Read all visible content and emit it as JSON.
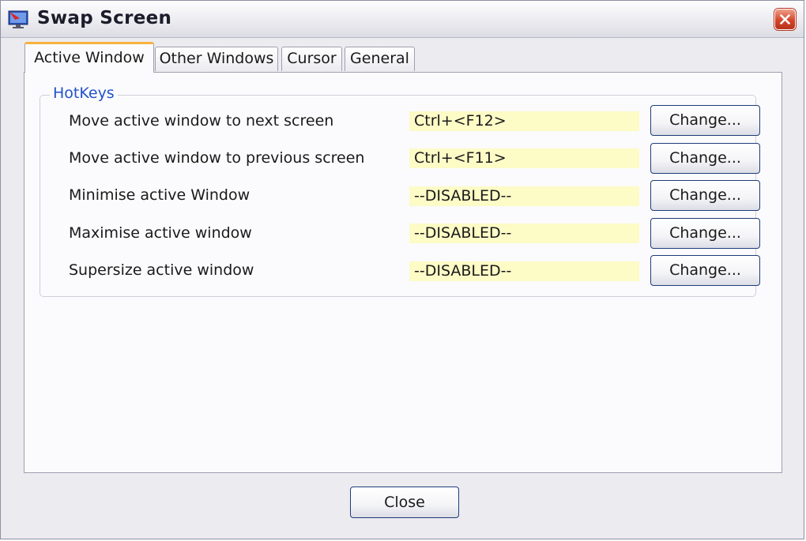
{
  "window": {
    "title": "Swap Screen",
    "icon": "monitor-swap-icon",
    "close_icon": "close-x-icon"
  },
  "tabs": [
    {
      "label": "Active Window",
      "selected": true
    },
    {
      "label": "Other Windows",
      "selected": false
    },
    {
      "label": "Cursor",
      "selected": false
    },
    {
      "label": "General",
      "selected": false
    }
  ],
  "hotkeys": {
    "group_label": "HotKeys",
    "rows": [
      {
        "label": "Move active window to next screen",
        "value": "Ctrl+<F12>",
        "button": "Change..."
      },
      {
        "label": "Move active window to previous screen",
        "value": "Ctrl+<F11>",
        "button": "Change..."
      },
      {
        "label": "Minimise active Window",
        "value": "--DISABLED--",
        "button": "Change..."
      },
      {
        "label": "Maximise active window",
        "value": "--DISABLED--",
        "button": "Change..."
      },
      {
        "label": "Supersize active window",
        "value": "--DISABLED--",
        "button": "Change..."
      }
    ]
  },
  "footer": {
    "close_label": "Close"
  },
  "colors": {
    "hotkey_field_bg": "#fdfbc6",
    "group_label": "#2152c9",
    "active_tab_accent": "#f7b23c",
    "button_border": "#1f3d7a"
  }
}
